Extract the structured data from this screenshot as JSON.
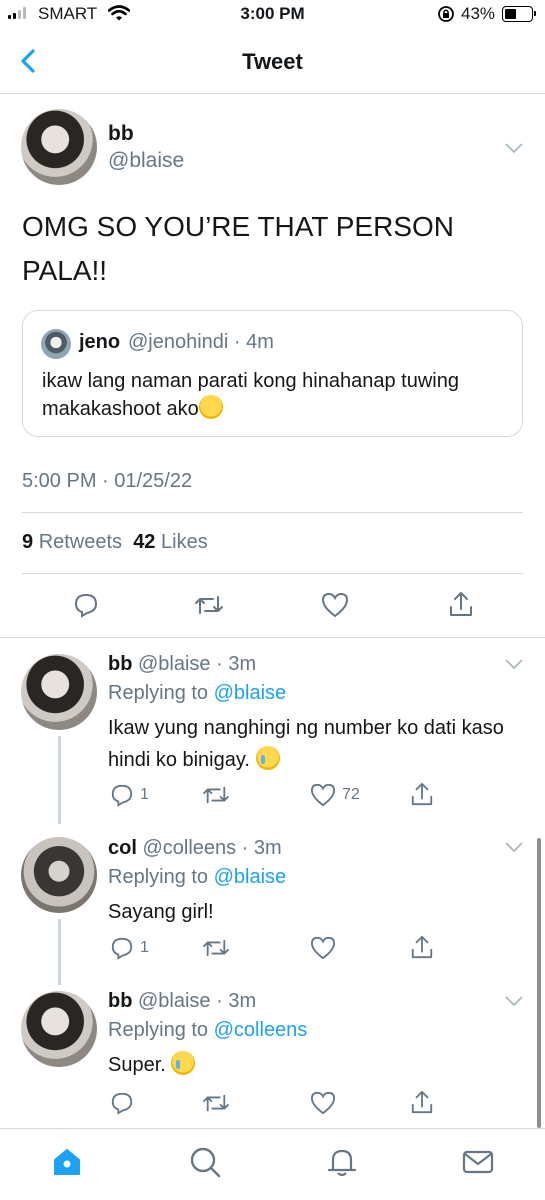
{
  "status_bar": {
    "carrier": "SMART",
    "time": "3:00 PM",
    "battery": "43%",
    "battery_level": 0.43
  },
  "header": {
    "title": "Tweet",
    "back_icon": "chevron-left-icon"
  },
  "main_tweet": {
    "name": "bb",
    "handle": "@blaise",
    "text": "OMG SO YOU’RE THAT PERSON PALA!!",
    "quote": {
      "name": "jeno",
      "meta": "@jenohindi · 4m",
      "text": "ikaw lang naman parati kong hinahanap tuwing makakashoot ako"
    },
    "timestamp": "5:00 PM · 01/25/22",
    "retweets_count": "9",
    "retweets_label": "Retweets",
    "likes_count": "42",
    "likes_label": "Likes"
  },
  "replies": [
    {
      "name": "bb",
      "meta": "@blaise · 3m",
      "replying_prefix": "Replying to",
      "replying_to": "@blaise",
      "text": "Ikaw yung nanghingi ng number ko dati kaso hindi ko binigay.",
      "reply_count": "1",
      "like_count": "72"
    },
    {
      "name": "col",
      "meta": "@colleens · 3m",
      "replying_prefix": "Replying to",
      "replying_to": "@blaise",
      "text": "Sayang girl!",
      "reply_count": "1"
    },
    {
      "name": "bb",
      "meta": "@blaise · 3m",
      "replying_prefix": "Replying to",
      "replying_to": "@colleens",
      "text": "Super."
    }
  ],
  "tab_bar": [
    "home-icon",
    "search-icon",
    "bell-icon",
    "mail-icon"
  ],
  "colors": {
    "accent": "#1da1f2",
    "secondary_text": "#657786",
    "divider": "#d6d9db"
  }
}
